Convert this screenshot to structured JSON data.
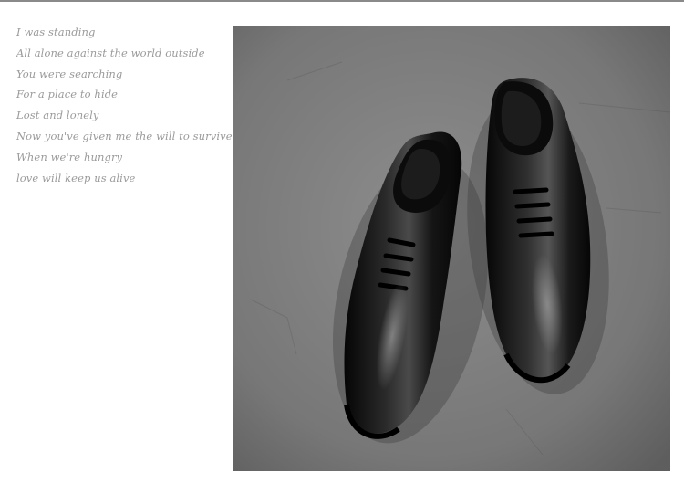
{
  "poem": {
    "lines": [
      "I was standing",
      "All alone against the world outside",
      "You were searching",
      "For a place to hide",
      "Lost and lonely",
      "Now you've given me the will to survive",
      "When we're hungry",
      "love will keep us alive"
    ]
  },
  "photo": {
    "subject": "black-leather-oxford-shoes",
    "background_color": "#7d7d7d"
  }
}
